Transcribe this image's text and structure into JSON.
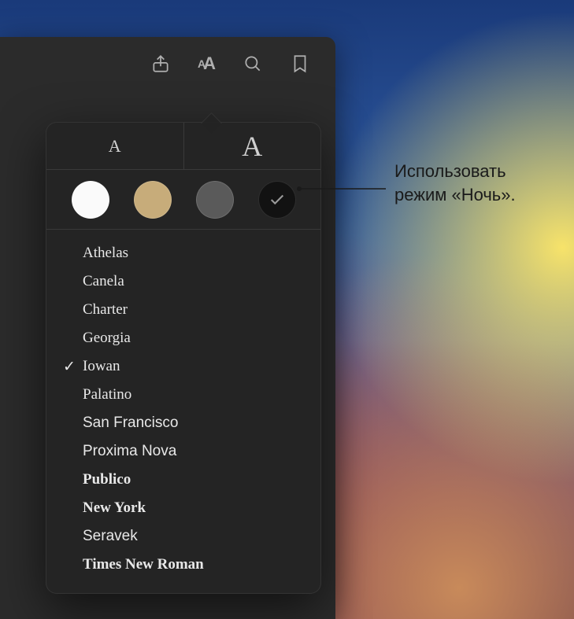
{
  "toolbar": {
    "share_name": "share-icon",
    "appearance_name": "appearance-icon",
    "search_name": "search-icon",
    "bookmark_name": "bookmark-icon"
  },
  "popover": {
    "size_small_glyph": "A",
    "size_large_glyph": "A",
    "themes": [
      {
        "name": "theme-white",
        "class": "swatch-white"
      },
      {
        "name": "theme-sepia",
        "class": "swatch-sepia"
      },
      {
        "name": "theme-gray",
        "class": "swatch-gray"
      },
      {
        "name": "theme-night",
        "class": "swatch-night",
        "checked": true
      }
    ],
    "fonts": [
      {
        "label": "Athelas",
        "selected": false
      },
      {
        "label": "Canela",
        "selected": false
      },
      {
        "label": "Charter",
        "selected": false
      },
      {
        "label": "Georgia",
        "selected": false
      },
      {
        "label": "Iowan",
        "selected": true
      },
      {
        "label": "Palatino",
        "selected": false
      },
      {
        "label": "San Francisco",
        "selected": false
      },
      {
        "label": "Proxima Nova",
        "selected": false
      },
      {
        "label": "Publico",
        "selected": false
      },
      {
        "label": "New York",
        "selected": false
      },
      {
        "label": "Seravek",
        "selected": false
      },
      {
        "label": "Times New Roman",
        "selected": false
      }
    ]
  },
  "callout": {
    "line1": "Использовать",
    "line2": "режим «Ночь»."
  }
}
